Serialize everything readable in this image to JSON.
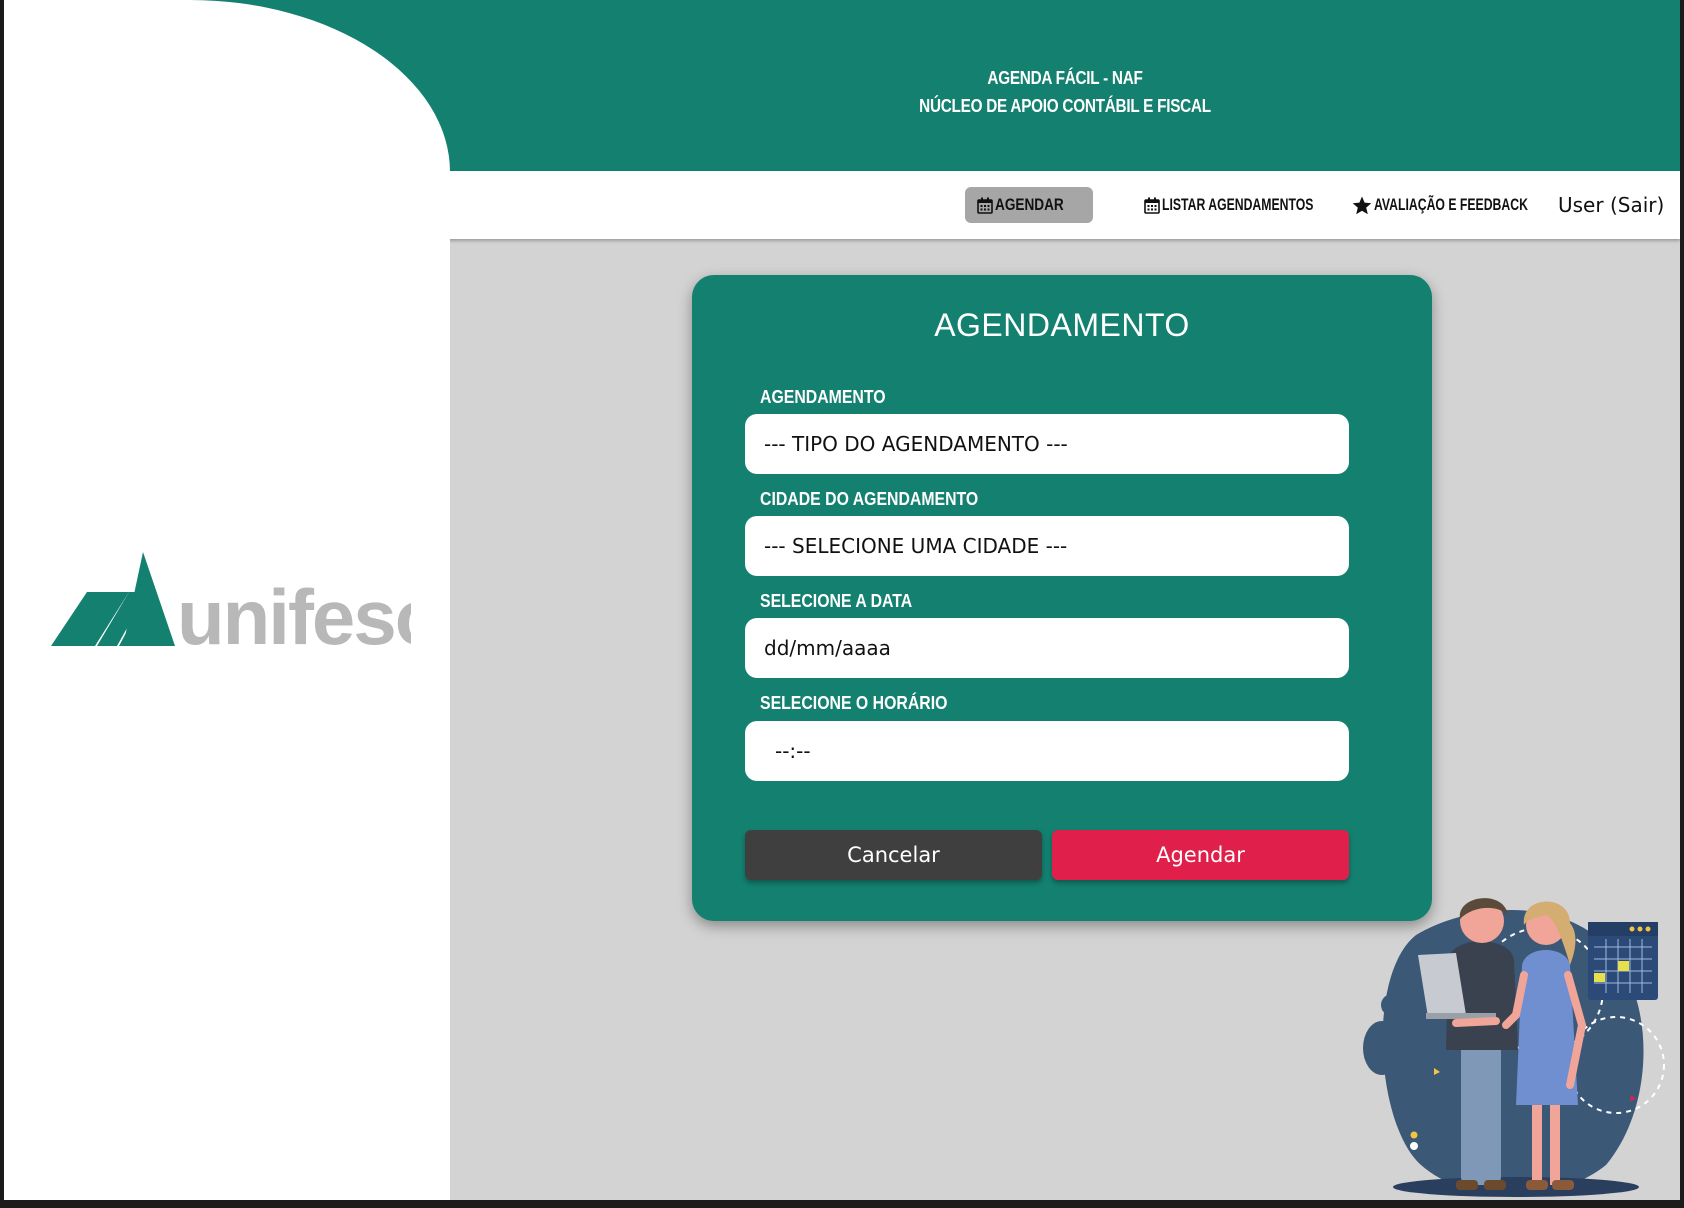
{
  "header": {
    "line1": "AGENDA FÁCIL - NAF",
    "line2": "NÚCLEO DE APOIO CONTÁBIL E FISCAL"
  },
  "brand": {
    "logo_text": "unifeso",
    "color": "#138070"
  },
  "nav": {
    "items": [
      {
        "icon": "calendar-icon",
        "label": "AGENDAR",
        "active": true
      },
      {
        "icon": "calendar-icon",
        "label": "LISTAR AGENDAMENTOS",
        "active": false
      },
      {
        "icon": "star-icon",
        "label": "AVALIAÇÃO E FEEDBACK",
        "active": false
      }
    ],
    "user": "User (Sair)"
  },
  "form": {
    "title": "AGENDAMENTO",
    "fields": [
      {
        "label": "AGENDAMENTO",
        "value": "--- TIPO DO AGENDAMENTO ---",
        "kind": "select"
      },
      {
        "label": "CIDADE DO AGENDAMENTO",
        "value": "--- SELECIONE UMA CIDADE ---",
        "kind": "select"
      },
      {
        "label": "SELECIONE A DATA",
        "value": "dd/mm/aaaa",
        "kind": "date"
      },
      {
        "label": "SELECIONE O HORÁRIO",
        "value": "--:--",
        "kind": "time"
      }
    ],
    "cancel_label": "Cancelar",
    "submit_label": "Agendar"
  },
  "colors": {
    "primary": "#138070",
    "accent": "#e0204a",
    "dark_button": "#3f3f3f",
    "background": "#d3d3d3"
  }
}
